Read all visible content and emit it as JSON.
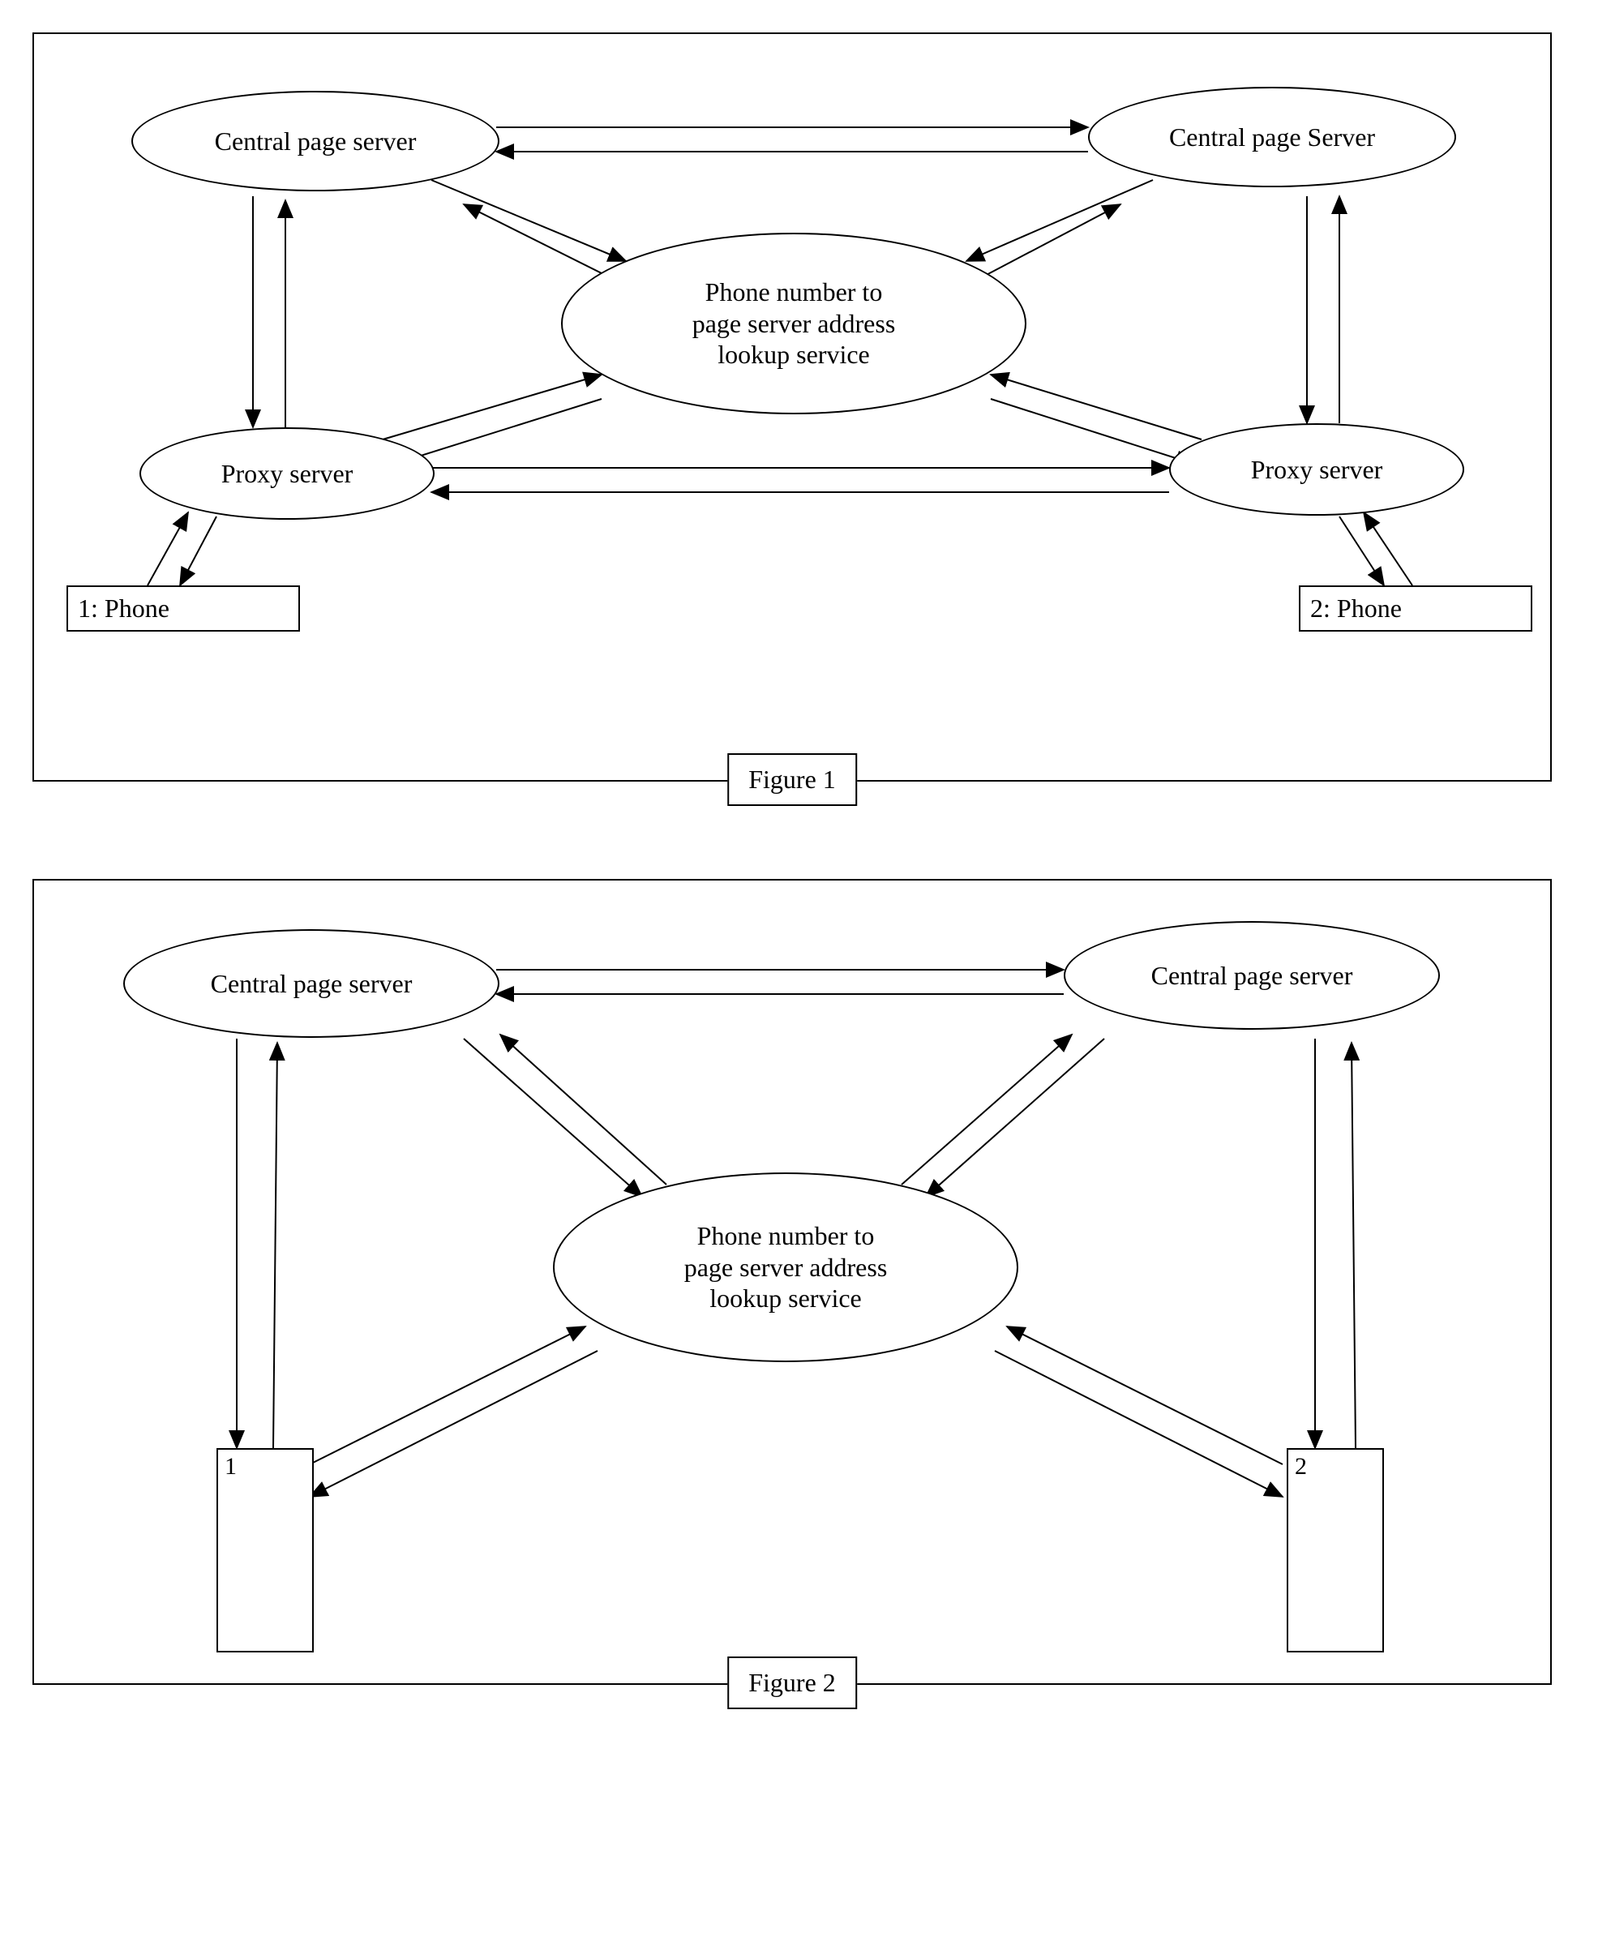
{
  "figure1": {
    "caption": "Figure 1",
    "nodes": {
      "cps_left": "Central page server",
      "cps_right": "Central page Server",
      "lookup": "Phone number to\npage server address\nlookup service",
      "proxy_left": "Proxy server",
      "proxy_right": "Proxy server",
      "phone1": "1: Phone",
      "phone2": "2: Phone"
    },
    "connections": [
      {
        "from": "cps_left",
        "to": "cps_right",
        "bidirectional": true
      },
      {
        "from": "cps_left",
        "to": "lookup",
        "bidirectional": true
      },
      {
        "from": "cps_right",
        "to": "lookup",
        "bidirectional": true
      },
      {
        "from": "cps_left",
        "to": "proxy_left",
        "bidirectional": true
      },
      {
        "from": "cps_right",
        "to": "proxy_right",
        "bidirectional": true
      },
      {
        "from": "proxy_left",
        "to": "lookup",
        "bidirectional": true
      },
      {
        "from": "proxy_right",
        "to": "lookup",
        "bidirectional": true
      },
      {
        "from": "proxy_left",
        "to": "proxy_right",
        "bidirectional": true
      },
      {
        "from": "phone1",
        "to": "proxy_left",
        "bidirectional": true
      },
      {
        "from": "phone2",
        "to": "proxy_right",
        "bidirectional": true
      }
    ]
  },
  "figure2": {
    "caption": "Figure 2",
    "nodes": {
      "cps_left": "Central page server",
      "cps_right": "Central page server",
      "lookup": "Phone number to\npage server address\nlookup service",
      "node1": "1",
      "node2": "2"
    },
    "connections": [
      {
        "from": "cps_left",
        "to": "cps_right",
        "bidirectional": true
      },
      {
        "from": "cps_left",
        "to": "lookup",
        "bidirectional": true
      },
      {
        "from": "cps_right",
        "to": "lookup",
        "bidirectional": true
      },
      {
        "from": "cps_left",
        "to": "node1",
        "bidirectional": true
      },
      {
        "from": "cps_right",
        "to": "node2",
        "bidirectional": true
      },
      {
        "from": "node1",
        "to": "lookup",
        "bidirectional": true
      },
      {
        "from": "node2",
        "to": "lookup",
        "bidirectional": true
      }
    ]
  }
}
